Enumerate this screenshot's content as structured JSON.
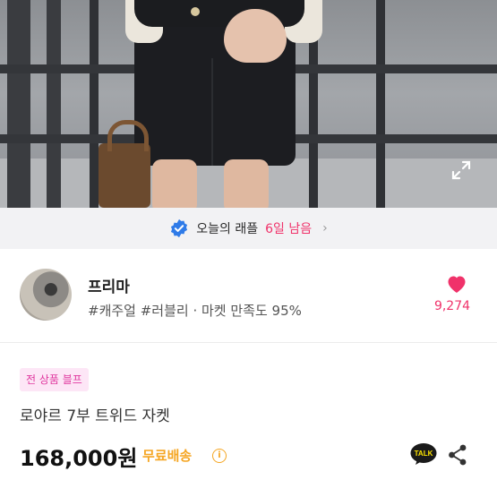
{
  "banner": {
    "text": "오늘의 래플",
    "days": "6일 남음",
    "chevron": "›"
  },
  "seller": {
    "name": "프리마",
    "tags": "#캐주얼 #러블리 · 마켓 만족도 95%",
    "likes": "9,274"
  },
  "product": {
    "badge": "전 상품 블프",
    "title": "로야르 7부 트위드 자켓",
    "price": "168,000원",
    "shipping": "무료배송",
    "info_icon": "i",
    "talk_label": "TALK"
  },
  "colors": {
    "accent_pink": "#f0326a",
    "badge_bg": "#fde6f6",
    "badge_text": "#e0389f",
    "shipping": "#f5a623",
    "verified_blue": "#2f7be8"
  }
}
